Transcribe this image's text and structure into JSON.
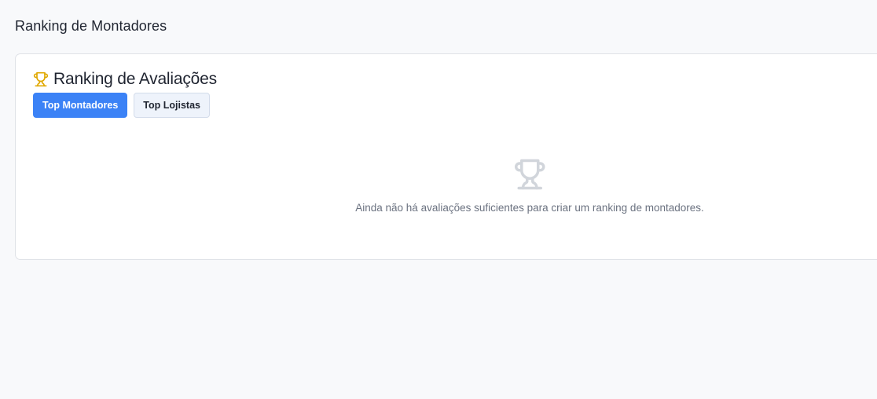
{
  "page": {
    "title": "Ranking de Montadores"
  },
  "card": {
    "title": "Ranking de Avaliações",
    "title_icon": "trophy-icon",
    "tabs": [
      {
        "label": "Top Montadores",
        "active": true
      },
      {
        "label": "Top Lojistas",
        "active": false
      }
    ],
    "empty_state": {
      "icon": "trophy-icon",
      "message": "Ainda não há avaliações suficientes para criar um ranking de montadores."
    }
  },
  "colors": {
    "accent": "#3b82f6",
    "trophy": "#e0a800",
    "muted_icon": "#d1d5db",
    "background": "#f8f9fb"
  }
}
